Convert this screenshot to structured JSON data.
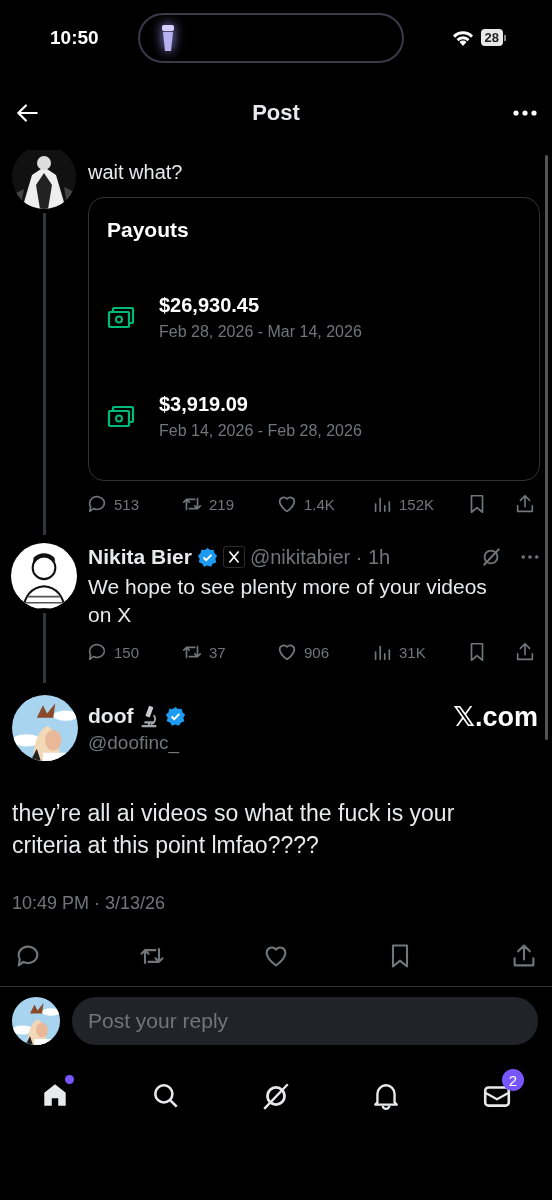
{
  "status_bar": {
    "time": "10:50",
    "battery": "28"
  },
  "header": {
    "title": "Post"
  },
  "parent_post": {
    "text": "wait what?",
    "card": {
      "title": "Payouts",
      "payouts": [
        {
          "amount": "$26,930.45",
          "period": "Feb 28, 2026 - Mar 14, 2026"
        },
        {
          "amount": "$3,919.09",
          "period": "Feb 14, 2026 - Feb 28, 2026"
        }
      ]
    },
    "actions": [
      {
        "kind": "reply",
        "count": "513"
      },
      {
        "kind": "repost",
        "count": "219"
      },
      {
        "kind": "like",
        "count": "1.4K"
      },
      {
        "kind": "views",
        "count": "152K"
      },
      {
        "kind": "bookmark"
      },
      {
        "kind": "share"
      }
    ]
  },
  "reply_post": {
    "name": "Nikita Bier",
    "verified": true,
    "affiliate": true,
    "handle": "@nikitabier · 1h",
    "text": "We hope to see plenty more of your videos on X",
    "actions": [
      {
        "kind": "reply",
        "count": "150"
      },
      {
        "kind": "repost",
        "count": "37"
      },
      {
        "kind": "like",
        "count": "906"
      },
      {
        "kind": "views",
        "count": "31K"
      },
      {
        "kind": "bookmark"
      },
      {
        "kind": "share"
      }
    ]
  },
  "main_post": {
    "name": "doof",
    "verified": true,
    "handle": "@doofinc_",
    "link": "𝕏.com",
    "text": "they’re all ai videos so what the fuck is your criteria at this point lmfao????",
    "timestamp": "10:49 PM · 3/13/26",
    "actions": [
      {
        "kind": "reply"
      },
      {
        "kind": "repost"
      },
      {
        "kind": "like"
      },
      {
        "kind": "bookmark"
      },
      {
        "kind": "share"
      }
    ]
  },
  "reply_box": {
    "placeholder": "Post your reply"
  },
  "tab_bar": [
    {
      "kind": "home",
      "selected": true,
      "dot": true
    },
    {
      "kind": "search",
      "selected": false
    },
    {
      "kind": "grok",
      "selected": false
    },
    {
      "kind": "bell",
      "selected": false
    },
    {
      "kind": "mail",
      "selected": false,
      "badge": "2"
    }
  ]
}
